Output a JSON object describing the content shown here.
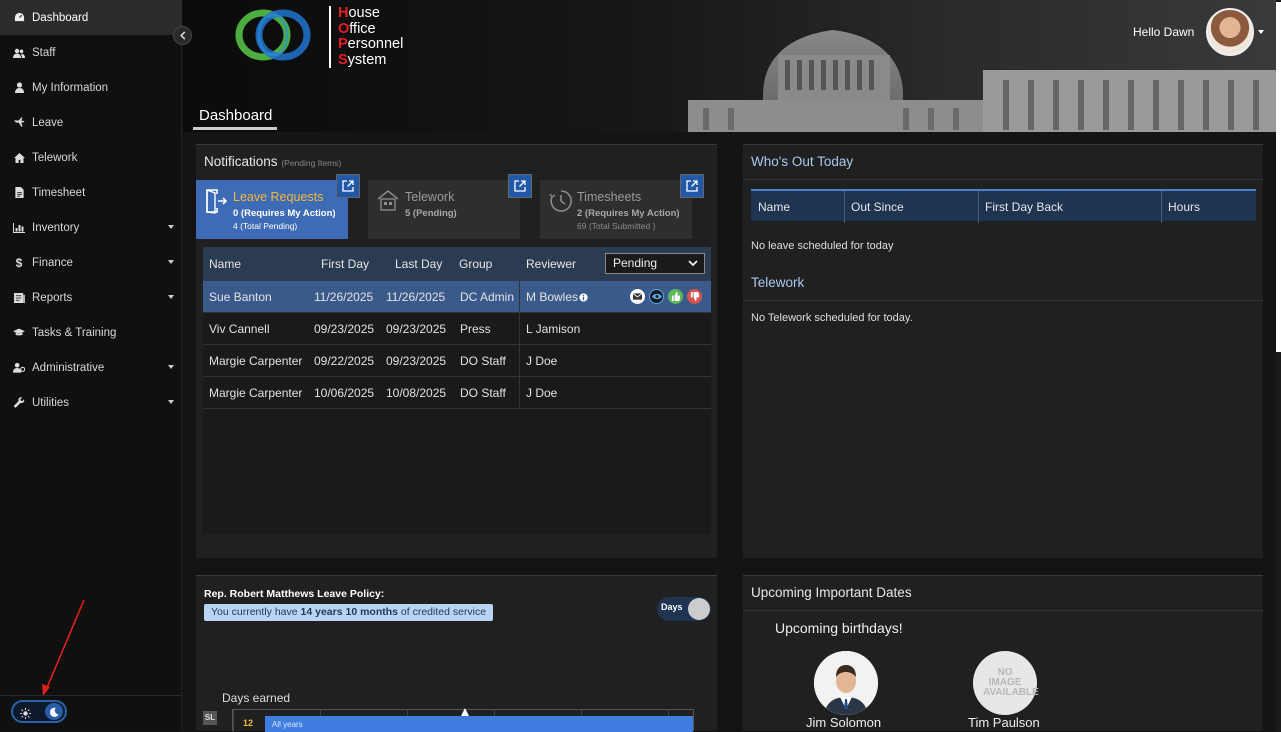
{
  "sidebar": {
    "items": [
      {
        "label": "Dashboard",
        "icon": "dashboard-icon",
        "active": true
      },
      {
        "label": "Staff",
        "icon": "users-icon"
      },
      {
        "label": "My Information",
        "icon": "user-icon"
      },
      {
        "label": "Leave",
        "icon": "plane-icon"
      },
      {
        "label": "Telework",
        "icon": "home-icon"
      },
      {
        "label": "Timesheet",
        "icon": "document-icon"
      },
      {
        "label": "Inventory",
        "icon": "bar-chart-icon",
        "has_submenu": true
      },
      {
        "label": "Finance",
        "icon": "dollar-icon",
        "has_submenu": true
      },
      {
        "label": "Reports",
        "icon": "report-icon",
        "has_submenu": true
      },
      {
        "label": "Tasks & Training",
        "icon": "graduation-cap-icon"
      },
      {
        "label": "Administrative",
        "icon": "user-cog-icon",
        "has_submenu": true
      },
      {
        "label": "Utilities",
        "icon": "wrench-icon",
        "has_submenu": true
      }
    ],
    "theme_mode": "dark"
  },
  "header": {
    "logo_lines": [
      {
        "initial": "H",
        "rest": "ouse"
      },
      {
        "initial": "O",
        "rest": "ffice"
      },
      {
        "initial": "P",
        "rest": "ersonnel"
      },
      {
        "initial": "S",
        "rest": "ystem"
      }
    ],
    "greeting": "Hello Dawn",
    "page_title": "Dashboard"
  },
  "notifications": {
    "title": "Notifications",
    "subtitle": "(Pending Items)",
    "tabs": [
      {
        "title": "Leave Requests",
        "line1": "0 (Requires My Action)",
        "line2": "4 (Total Pending)",
        "active": true
      },
      {
        "title": "Telework",
        "line1": "5 (Pending)",
        "line2": ""
      },
      {
        "title": "Timesheets",
        "line1": "2 (Requires My Action)",
        "line2": "69 (Total Submitted )"
      }
    ],
    "table": {
      "columns": [
        "Name",
        "First Day",
        "Last Day",
        "Group",
        "Reviewer"
      ],
      "filter_value": "Pending",
      "rows": [
        {
          "name": "Sue Banton",
          "first": "11/26/2025",
          "last": "11/26/2025",
          "group": "DC Admin",
          "reviewer": "M Bowles",
          "selected": true
        },
        {
          "name": "Viv Cannell",
          "first": "09/23/2025",
          "last": "09/23/2025",
          "group": "Press",
          "reviewer": "L Jamison"
        },
        {
          "name": "Margie Carpenter",
          "first": "09/22/2025",
          "last": "09/23/2025",
          "group": "DO Staff",
          "reviewer": "J Doe"
        },
        {
          "name": "Margie Carpenter",
          "first": "10/06/2025",
          "last": "10/08/2025",
          "group": "DO Staff",
          "reviewer": "J Doe"
        }
      ]
    }
  },
  "whos_out": {
    "title": "Who's Out Today",
    "columns": [
      "Name",
      "Out Since",
      "First Day Back",
      "Hours"
    ],
    "empty_text": "No leave scheduled for today",
    "telework_title": "Telework",
    "telework_empty": "No Telework scheduled for today."
  },
  "leave_policy": {
    "title": "Rep. Robert Matthews Leave Policy:",
    "service_prefix": "You currently have ",
    "service_value": "14 years 10 months",
    "service_suffix": " of credited service",
    "toggle_label": "Days",
    "chart_title": "Days earned",
    "chart_data": {
      "type": "bar",
      "categories": [
        "SL"
      ],
      "series": [
        {
          "name": "All years",
          "values": [
            12
          ]
        }
      ]
    },
    "bar_fraction": 1.0
  },
  "important_dates": {
    "title": "Upcoming Important Dates",
    "birthdays_title": "Upcoming birthdays!",
    "people": [
      {
        "name": "Jim Solomon"
      },
      {
        "name": "Tim Paulson",
        "placeholder_text": "NO IMAGE AVAILABLE"
      }
    ]
  }
}
